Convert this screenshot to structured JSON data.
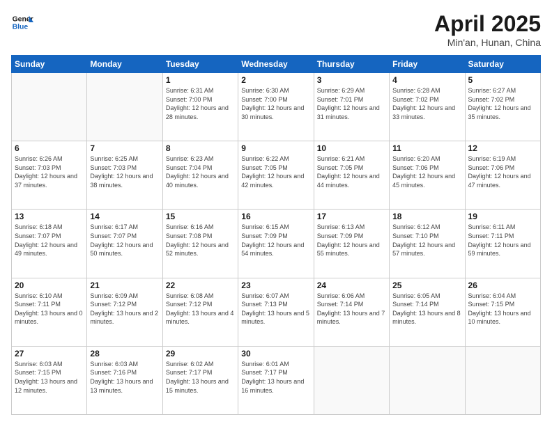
{
  "header": {
    "logo_general": "General",
    "logo_blue": "Blue",
    "month_title": "April 2025",
    "location": "Min'an, Hunan, China"
  },
  "weekdays": [
    "Sunday",
    "Monday",
    "Tuesday",
    "Wednesday",
    "Thursday",
    "Friday",
    "Saturday"
  ],
  "weeks": [
    [
      {
        "day": "",
        "sunrise": "",
        "sunset": "",
        "daylight": ""
      },
      {
        "day": "",
        "sunrise": "",
        "sunset": "",
        "daylight": ""
      },
      {
        "day": "1",
        "sunrise": "Sunrise: 6:31 AM",
        "sunset": "Sunset: 7:00 PM",
        "daylight": "Daylight: 12 hours and 28 minutes."
      },
      {
        "day": "2",
        "sunrise": "Sunrise: 6:30 AM",
        "sunset": "Sunset: 7:00 PM",
        "daylight": "Daylight: 12 hours and 30 minutes."
      },
      {
        "day": "3",
        "sunrise": "Sunrise: 6:29 AM",
        "sunset": "Sunset: 7:01 PM",
        "daylight": "Daylight: 12 hours and 31 minutes."
      },
      {
        "day": "4",
        "sunrise": "Sunrise: 6:28 AM",
        "sunset": "Sunset: 7:02 PM",
        "daylight": "Daylight: 12 hours and 33 minutes."
      },
      {
        "day": "5",
        "sunrise": "Sunrise: 6:27 AM",
        "sunset": "Sunset: 7:02 PM",
        "daylight": "Daylight: 12 hours and 35 minutes."
      }
    ],
    [
      {
        "day": "6",
        "sunrise": "Sunrise: 6:26 AM",
        "sunset": "Sunset: 7:03 PM",
        "daylight": "Daylight: 12 hours and 37 minutes."
      },
      {
        "day": "7",
        "sunrise": "Sunrise: 6:25 AM",
        "sunset": "Sunset: 7:03 PM",
        "daylight": "Daylight: 12 hours and 38 minutes."
      },
      {
        "day": "8",
        "sunrise": "Sunrise: 6:23 AM",
        "sunset": "Sunset: 7:04 PM",
        "daylight": "Daylight: 12 hours and 40 minutes."
      },
      {
        "day": "9",
        "sunrise": "Sunrise: 6:22 AM",
        "sunset": "Sunset: 7:05 PM",
        "daylight": "Daylight: 12 hours and 42 minutes."
      },
      {
        "day": "10",
        "sunrise": "Sunrise: 6:21 AM",
        "sunset": "Sunset: 7:05 PM",
        "daylight": "Daylight: 12 hours and 44 minutes."
      },
      {
        "day": "11",
        "sunrise": "Sunrise: 6:20 AM",
        "sunset": "Sunset: 7:06 PM",
        "daylight": "Daylight: 12 hours and 45 minutes."
      },
      {
        "day": "12",
        "sunrise": "Sunrise: 6:19 AM",
        "sunset": "Sunset: 7:06 PM",
        "daylight": "Daylight: 12 hours and 47 minutes."
      }
    ],
    [
      {
        "day": "13",
        "sunrise": "Sunrise: 6:18 AM",
        "sunset": "Sunset: 7:07 PM",
        "daylight": "Daylight: 12 hours and 49 minutes."
      },
      {
        "day": "14",
        "sunrise": "Sunrise: 6:17 AM",
        "sunset": "Sunset: 7:07 PM",
        "daylight": "Daylight: 12 hours and 50 minutes."
      },
      {
        "day": "15",
        "sunrise": "Sunrise: 6:16 AM",
        "sunset": "Sunset: 7:08 PM",
        "daylight": "Daylight: 12 hours and 52 minutes."
      },
      {
        "day": "16",
        "sunrise": "Sunrise: 6:15 AM",
        "sunset": "Sunset: 7:09 PM",
        "daylight": "Daylight: 12 hours and 54 minutes."
      },
      {
        "day": "17",
        "sunrise": "Sunrise: 6:13 AM",
        "sunset": "Sunset: 7:09 PM",
        "daylight": "Daylight: 12 hours and 55 minutes."
      },
      {
        "day": "18",
        "sunrise": "Sunrise: 6:12 AM",
        "sunset": "Sunset: 7:10 PM",
        "daylight": "Daylight: 12 hours and 57 minutes."
      },
      {
        "day": "19",
        "sunrise": "Sunrise: 6:11 AM",
        "sunset": "Sunset: 7:11 PM",
        "daylight": "Daylight: 12 hours and 59 minutes."
      }
    ],
    [
      {
        "day": "20",
        "sunrise": "Sunrise: 6:10 AM",
        "sunset": "Sunset: 7:11 PM",
        "daylight": "Daylight: 13 hours and 0 minutes."
      },
      {
        "day": "21",
        "sunrise": "Sunrise: 6:09 AM",
        "sunset": "Sunset: 7:12 PM",
        "daylight": "Daylight: 13 hours and 2 minutes."
      },
      {
        "day": "22",
        "sunrise": "Sunrise: 6:08 AM",
        "sunset": "Sunset: 7:12 PM",
        "daylight": "Daylight: 13 hours and 4 minutes."
      },
      {
        "day": "23",
        "sunrise": "Sunrise: 6:07 AM",
        "sunset": "Sunset: 7:13 PM",
        "daylight": "Daylight: 13 hours and 5 minutes."
      },
      {
        "day": "24",
        "sunrise": "Sunrise: 6:06 AM",
        "sunset": "Sunset: 7:14 PM",
        "daylight": "Daylight: 13 hours and 7 minutes."
      },
      {
        "day": "25",
        "sunrise": "Sunrise: 6:05 AM",
        "sunset": "Sunset: 7:14 PM",
        "daylight": "Daylight: 13 hours and 8 minutes."
      },
      {
        "day": "26",
        "sunrise": "Sunrise: 6:04 AM",
        "sunset": "Sunset: 7:15 PM",
        "daylight": "Daylight: 13 hours and 10 minutes."
      }
    ],
    [
      {
        "day": "27",
        "sunrise": "Sunrise: 6:03 AM",
        "sunset": "Sunset: 7:15 PM",
        "daylight": "Daylight: 13 hours and 12 minutes."
      },
      {
        "day": "28",
        "sunrise": "Sunrise: 6:03 AM",
        "sunset": "Sunset: 7:16 PM",
        "daylight": "Daylight: 13 hours and 13 minutes."
      },
      {
        "day": "29",
        "sunrise": "Sunrise: 6:02 AM",
        "sunset": "Sunset: 7:17 PM",
        "daylight": "Daylight: 13 hours and 15 minutes."
      },
      {
        "day": "30",
        "sunrise": "Sunrise: 6:01 AM",
        "sunset": "Sunset: 7:17 PM",
        "daylight": "Daylight: 13 hours and 16 minutes."
      },
      {
        "day": "",
        "sunrise": "",
        "sunset": "",
        "daylight": ""
      },
      {
        "day": "",
        "sunrise": "",
        "sunset": "",
        "daylight": ""
      },
      {
        "day": "",
        "sunrise": "",
        "sunset": "",
        "daylight": ""
      }
    ]
  ]
}
